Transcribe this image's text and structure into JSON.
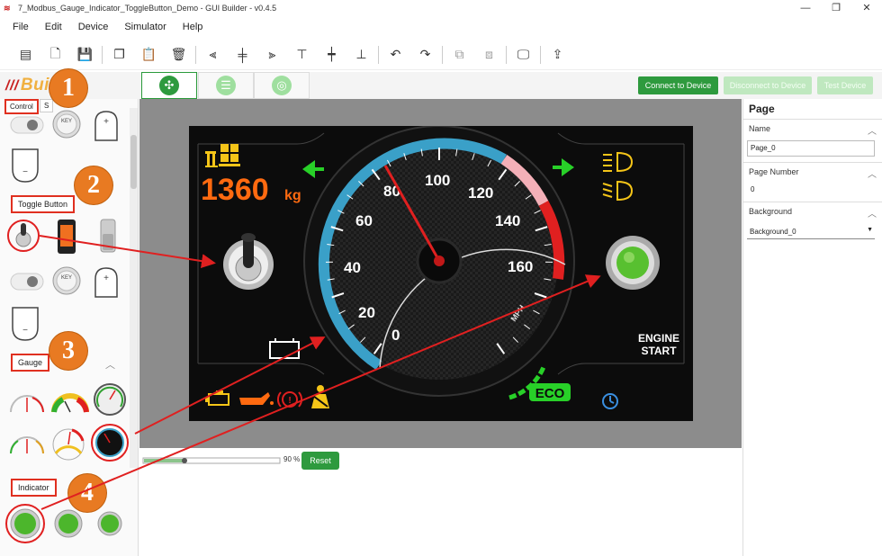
{
  "window": {
    "title": "7_Modbus_Gauge_Indicator_ToggleButton_Demo - GUI Builder - v0.4.5",
    "minimize": "—",
    "maximize": "❐",
    "close": "✕"
  },
  "menu": [
    "File",
    "Edit",
    "Device",
    "Simulator",
    "Help"
  ],
  "toolbar_icons": [
    "new-page-icon",
    "new-file-icon",
    "save-icon",
    "copy-icon",
    "paste-icon",
    "delete-icon",
    "align-left-icon",
    "align-center-icon",
    "align-right-icon",
    "align-top-icon",
    "align-middle-icon",
    "align-bottom-icon",
    "undo-icon",
    "redo-icon",
    "bring-front-icon",
    "send-back-icon",
    "preview-icon",
    "upload-icon"
  ],
  "logo": {
    "text": "Builder"
  },
  "header_buttons": {
    "connect": "Connect to Device",
    "disconnect": "Disconnect to Device",
    "test": "Test Device"
  },
  "left_panel": {
    "tab_control": "Control",
    "tab_other": "S",
    "key_label": "KEY",
    "sections": {
      "toggle": "Toggle Button",
      "gauge": "Gauge",
      "indicator": "Indicator"
    }
  },
  "badges": [
    "1",
    "2",
    "3",
    "4"
  ],
  "dashboard": {
    "load_value": "1360",
    "load_unit": "kg",
    "gauge_ticks": [
      "0",
      "20",
      "40",
      "60",
      "80",
      "100",
      "120",
      "140",
      "160"
    ],
    "gauge_unit": "MPH",
    "engine_line1": "ENGINE",
    "engine_line2": "START",
    "eco": "ECO",
    "colors": {
      "accent_blue": "#3aa0c8",
      "red": "#e02020",
      "green": "#28d028",
      "orange": "#ff6a10",
      "yellow": "#f5c518"
    }
  },
  "zoom": {
    "percent": "90 %",
    "reset": "Reset",
    "level": 0.3
  },
  "right_panel": {
    "title": "Page",
    "name_label": "Name",
    "name_value": "Page_0",
    "page_number_label": "Page Number",
    "page_number_value": "0",
    "background_label": "Background",
    "background_value": "Background_0"
  }
}
